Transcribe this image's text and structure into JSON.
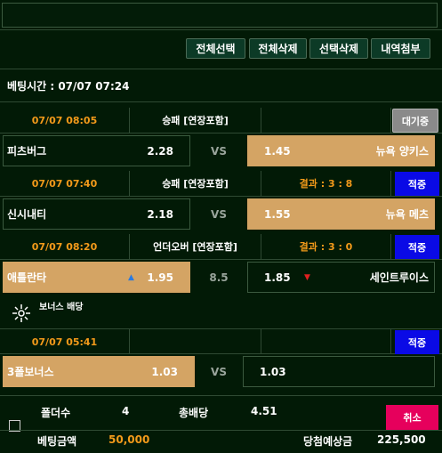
{
  "toolbar": {
    "select_all": "전체선택",
    "delete_all": "전체삭제",
    "delete_selected": "선택삭제",
    "attach_history": "내역첨부"
  },
  "bet_time": "베팅시간 : 07/07 07:24",
  "matches": [
    {
      "time": "07/07 08:05",
      "type": "승패 [연장포함]",
      "result": "",
      "status": "대기중",
      "home": "피츠버그",
      "home_odd": "2.28",
      "mid": "VS",
      "away_odd": "1.45",
      "away": "뉴욕 양키스"
    },
    {
      "time": "07/07 07:40",
      "type": "승패 [연장포함]",
      "result": "결과 : 3 : 8",
      "status": "적중",
      "home": "신시내티",
      "home_odd": "2.18",
      "mid": "VS",
      "away_odd": "1.55",
      "away": "뉴욕 메츠"
    },
    {
      "time": "07/07 08:20",
      "type": "언더오버 [연장포함]",
      "result": "결과 : 3 : 0",
      "status": "적중",
      "home": "애틀란타",
      "home_odd": "1.95",
      "mid": "8.5",
      "away_odd": "1.85",
      "away": "세인트루이스"
    },
    {
      "time": "07/07 05:41",
      "type": "",
      "result": "",
      "status": "적중",
      "home": "3폴보너스",
      "home_odd": "1.03",
      "mid": "VS",
      "away_odd": "1.03",
      "away": ""
    }
  ],
  "bonus_label": "보너스 배당",
  "footer": {
    "folder_label": "폴더수",
    "folder_value": "4",
    "total_odds_label": "총배당",
    "total_odds_value": "4.51",
    "cancel": "취소",
    "bet_amount_label": "베팅금액",
    "bet_amount_value": "50,000",
    "expected_label": "당첨예상금",
    "expected_value": "225,500"
  },
  "colors": {
    "orange": "#f39a1a",
    "selected": "#d4a464",
    "blue": "#0a0ae6",
    "cancel": "#e6005c",
    "bg": "#021a06"
  }
}
